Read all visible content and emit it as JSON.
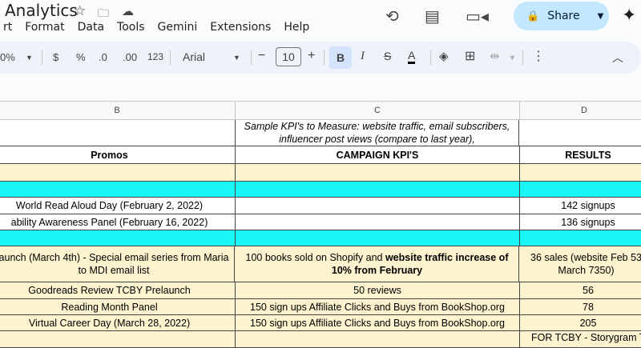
{
  "doc": {
    "title": "Analytics"
  },
  "menu": [
    "rt",
    "Format",
    "Data",
    "Tools",
    "Gemini",
    "Extensions",
    "Help"
  ],
  "share": {
    "label": "Share"
  },
  "toolbar": {
    "zoom": "0%",
    "currency": "$",
    "percent": "%",
    "dec_decrease": ".0",
    "dec_increase": ".00",
    "format123": "123",
    "font": "Arial",
    "font_size": "10",
    "bold": "B",
    "italic": "I",
    "strike": "S",
    "text_color": "A"
  },
  "columns": [
    "B",
    "C",
    "D"
  ],
  "rows": [
    {
      "type": "white",
      "b": "",
      "c": "Sample KPI's to Measure: website traffic, email subscribers, influencer post views (compare to last year),",
      "d": ""
    },
    {
      "type": "white",
      "b": "Promos",
      "c": "CAMPAIGN KPI'S",
      "d": "RESULTS"
    },
    {
      "type": "tan",
      "b": "",
      "c": "",
      "d": ""
    },
    {
      "type": "cyan",
      "b": "",
      "c": "",
      "d": ""
    },
    {
      "type": "white",
      "b": "World Read Aloud Day (February 2, 2022)",
      "c": "",
      "d": "142 signups"
    },
    {
      "type": "white",
      "b": "ability Awareness Panel (February 16, 2022)",
      "c": "",
      "d": "136 signups"
    },
    {
      "type": "cyan",
      "b": "",
      "c": "",
      "d": ""
    },
    {
      "type": "tan",
      "b": "aunch (March 4th) - Special email series from Maria to MDI email list",
      "c_plain": "100 books sold on Shopify and ",
      "c_bold": "website traffic increase of 10% from February",
      "d": "36 sales (website Feb 53 March 7350)"
    },
    {
      "type": "tan",
      "b": "Goodreads Review TCBY Prelaunch",
      "c": "50 reviews",
      "d": "56"
    },
    {
      "type": "tan",
      "b": "Reading Month Panel",
      "c": "150 sign ups Affiliate Clicks and Buys from BookShop.org",
      "d": "78"
    },
    {
      "type": "tan",
      "b": "Virtual Career Day (March 28, 2022)",
      "c": "150 sign ups Affiliate Clicks and Buys from BookShop.org",
      "d": "205"
    },
    {
      "type": "tan",
      "b": "",
      "c": "",
      "d": "FOR TCBY - Storygram T"
    }
  ]
}
